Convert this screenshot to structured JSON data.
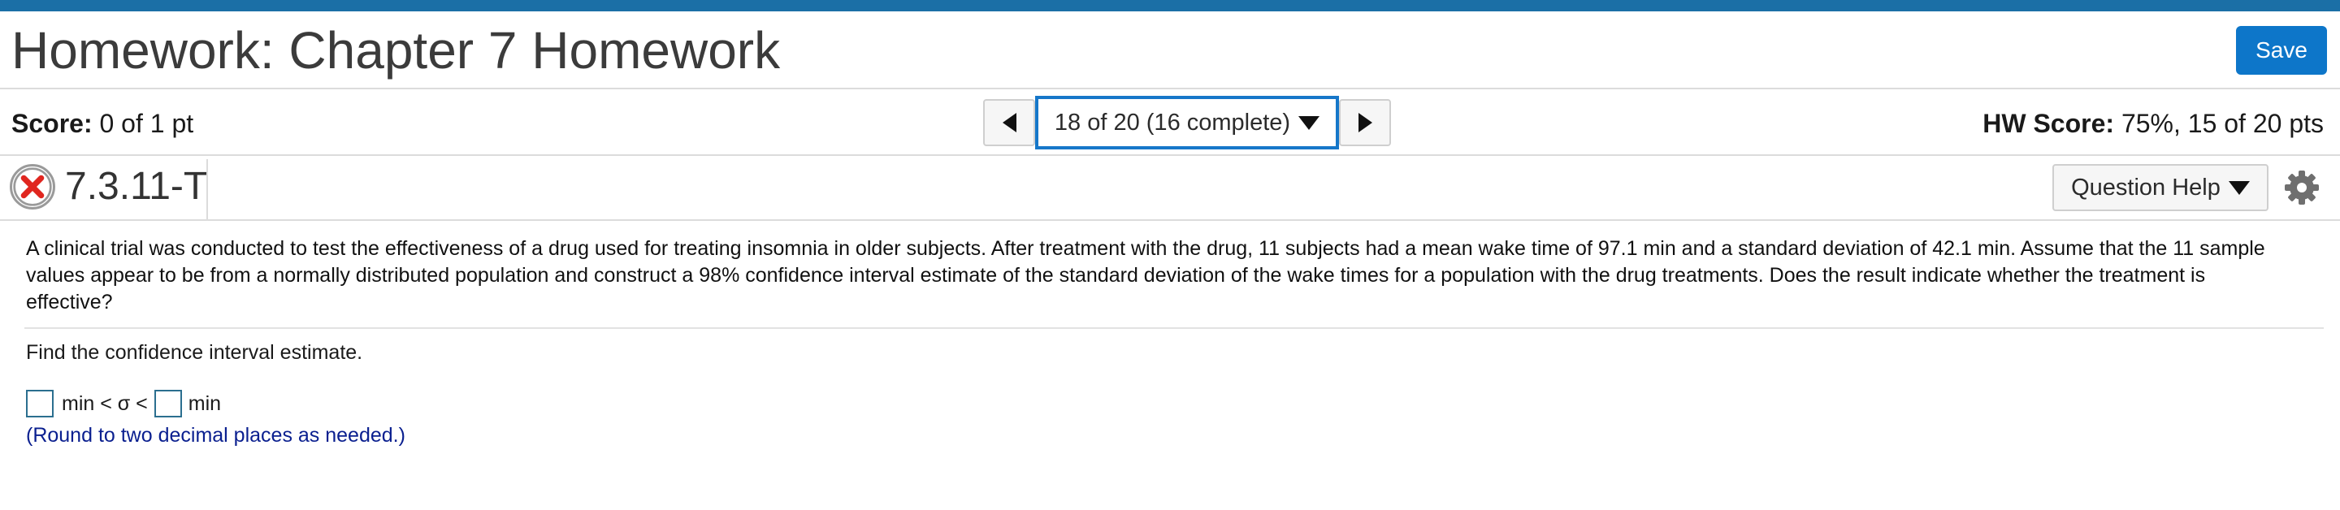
{
  "header": {
    "title": "Homework: Chapter 7 Homework",
    "save_label": "Save"
  },
  "score": {
    "label": "Score:",
    "value": "0 of 1 pt"
  },
  "hw_score": {
    "label": "HW Score:",
    "value": "75%, 15 of 20 pts"
  },
  "navigation": {
    "selector_text": "18 of 20 (16 complete)"
  },
  "question_header": {
    "id": "7.3.11-T",
    "status": "incorrect",
    "help_label": "Question Help"
  },
  "question": {
    "text": "A clinical trial was conducted to test the effectiveness of a drug used for treating insomnia in older subjects. After treatment with the drug, 11 subjects had a mean wake time of 97.1 min and a standard deviation of 42.1 min. Assume that the 11 sample values appear to be from a normally distributed population and construct a 98% confidence interval estimate of the standard deviation of the wake times for a population with the drug treatments. Does the result indicate whether the treatment is effective?",
    "prompt": "Find the confidence interval estimate.",
    "inequality_middle": "min < σ <",
    "inequality_unit": "min",
    "hint": "(Round to two decimal places as needed.)"
  },
  "icons": {
    "status": "red-x-circle-icon",
    "prev": "triangle-left-icon",
    "next": "triangle-right-icon",
    "dropdown": "caret-down-icon",
    "settings": "gear-icon"
  },
  "colors": {
    "accent": "#0d76c9",
    "top_bar": "#1b6fa6",
    "error": "#e0261f",
    "hint": "#0a1f8f"
  }
}
